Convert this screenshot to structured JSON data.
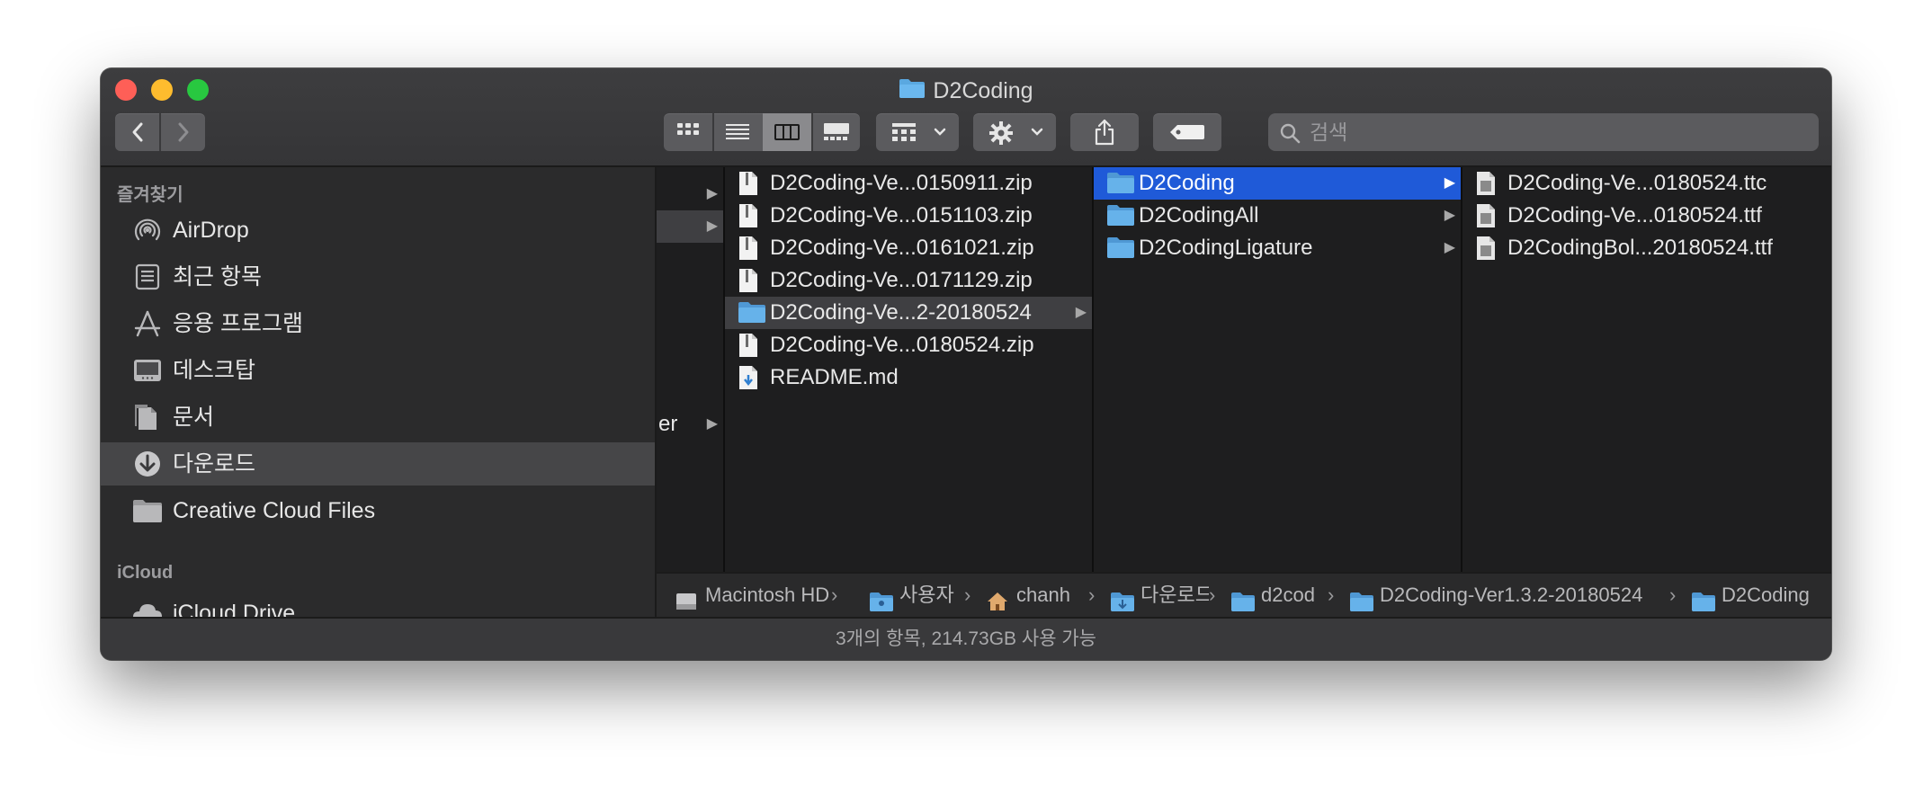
{
  "window": {
    "title": "D2Coding"
  },
  "toolbar": {
    "search_placeholder": "검색",
    "back_icon": "chevron-left-icon",
    "forward_icon": "chevron-right-icon",
    "views": [
      "icon-view-icon",
      "list-view-icon",
      "column-view-icon",
      "gallery-view-icon"
    ],
    "active_view": "column-view"
  },
  "sidebar": {
    "favorites_header": "즐겨찾기",
    "items": [
      {
        "label": "AirDrop",
        "icon": "airdrop-icon"
      },
      {
        "label": "최근 항목",
        "icon": "recents-icon"
      },
      {
        "label": "응용 프로그램",
        "icon": "applications-icon"
      },
      {
        "label": "데스크탑",
        "icon": "desktop-icon"
      },
      {
        "label": "문서",
        "icon": "documents-icon"
      },
      {
        "label": "다운로드",
        "icon": "downloads-icon",
        "selected": true
      },
      {
        "label": "Creative Cloud Files",
        "icon": "folder-icon"
      }
    ],
    "icloud_header": "iCloud",
    "icloud_items": [
      {
        "label": "iCloud Drive",
        "icon": "icloud-icon"
      }
    ]
  },
  "columns": {
    "col0": {
      "partial_label": "er"
    },
    "col1": [
      {
        "label": "D2Coding-Ve...0150911.zip",
        "type": "zip"
      },
      {
        "label": "D2Coding-Ve...0151103.zip",
        "type": "zip"
      },
      {
        "label": "D2Coding-Ve...0161021.zip",
        "type": "zip"
      },
      {
        "label": "D2Coding-Ve...0171129.zip",
        "type": "zip"
      },
      {
        "label": "D2Coding-Ve...2-20180524",
        "type": "folder",
        "selected": true
      },
      {
        "label": "D2Coding-Ve...0180524.zip",
        "type": "zip"
      },
      {
        "label": "README.md",
        "type": "md"
      }
    ],
    "col2": [
      {
        "label": "D2Coding",
        "type": "folder",
        "selected": true
      },
      {
        "label": "D2CodingAll",
        "type": "folder"
      },
      {
        "label": "D2CodingLigature",
        "type": "folder"
      }
    ],
    "col3": [
      {
        "label": "D2Coding-Ve...0180524.ttc",
        "type": "font"
      },
      {
        "label": "D2Coding-Ve...0180524.ttf",
        "type": "font"
      },
      {
        "label": "D2CodingBol...20180524.ttf",
        "type": "font"
      }
    ]
  },
  "pathbar": [
    {
      "label": "Macintosh HD",
      "icon": "hard-drive-icon"
    },
    {
      "label": "사용자",
      "icon": "users-folder-icon"
    },
    {
      "label": "chanh",
      "icon": "home-icon"
    },
    {
      "label": "다운로드",
      "icon": "downloads-folder-icon"
    },
    {
      "label": "d2cod",
      "icon": "folder-icon"
    },
    {
      "label": "D2Coding-Ver1.3.2-20180524",
      "icon": "folder-icon"
    },
    {
      "label": "D2Coding",
      "icon": "folder-icon"
    }
  ],
  "status": {
    "text": "3개의 항목, 214.73GB 사용 가능"
  },
  "colors": {
    "selection_blue": "#1f5ad8",
    "folder_blue": "#5aa8e0",
    "window_bg": "#2a2a2b"
  }
}
